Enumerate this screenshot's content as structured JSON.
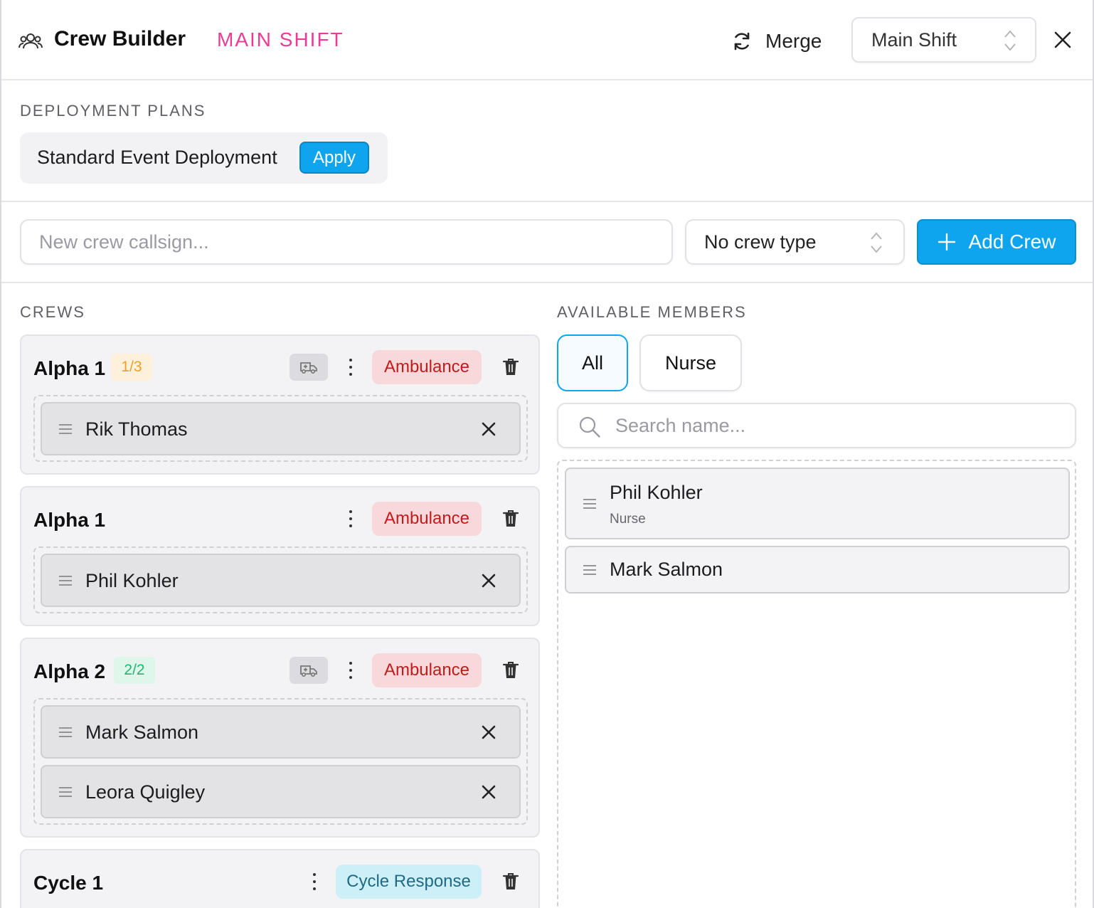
{
  "header": {
    "title": "Crew Builder",
    "shift_label": "MAIN SHIFT",
    "merge_label": "Merge",
    "shift_select_value": "Main Shift"
  },
  "deployment": {
    "section_label": "DEPLOYMENT PLANS",
    "plan_name": "Standard Event Deployment",
    "apply_label": "Apply"
  },
  "new_crew": {
    "callsign_placeholder": "New crew callsign...",
    "crew_type_value": "No crew type",
    "add_label": "Add Crew"
  },
  "crews": {
    "section_label": "CREWS",
    "items": [
      {
        "name": "Alpha 1",
        "count": "1/3",
        "type": "Ambulance",
        "members": [
          "Rik Thomas"
        ]
      },
      {
        "name": "Alpha 1",
        "type": "Ambulance",
        "members": [
          "Phil Kohler"
        ]
      },
      {
        "name": "Alpha 2",
        "count": "2/2",
        "type": "Ambulance",
        "members": [
          "Mark Salmon",
          "Leora Quigley"
        ]
      },
      {
        "name": "Cycle 1",
        "type": "Cycle Response",
        "members": []
      }
    ]
  },
  "available": {
    "section_label": "AVAILABLE MEMBERS",
    "filters": [
      "All",
      "Nurse"
    ],
    "active_filter": "All",
    "search_placeholder": "Search name...",
    "members": [
      {
        "name": "Phil Kohler",
        "role": "Nurse"
      },
      {
        "name": "Mark Salmon"
      }
    ]
  },
  "colors": {
    "accent": "#0ea5ee",
    "shift_pink": "#ea3c97",
    "ambulance_bg": "#f8d8da",
    "ambulance_text": "#c11b1b",
    "cycle_bg": "#cdeff7",
    "cycle_text": "#1f6a84",
    "count_warn": "#f0a020",
    "count_ok": "#22b573"
  }
}
